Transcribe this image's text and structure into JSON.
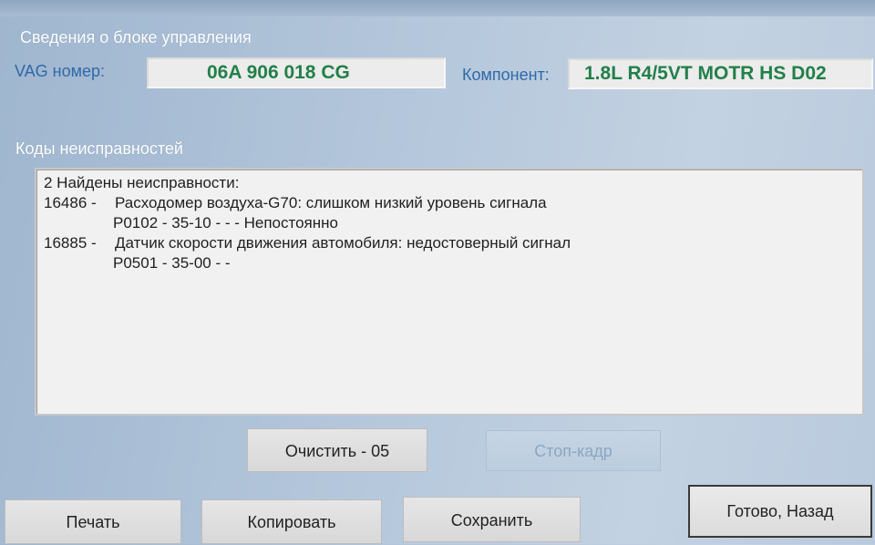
{
  "control_unit": {
    "section_title": "Сведения о блоке управления",
    "vag_label": "VAG номер:",
    "vag_value": "06A 906 018 CG",
    "component_label": "Компонент:",
    "component_value": "1.8L R4/5VT MOTR HS D02"
  },
  "faults": {
    "section_title": "Коды неисправностей",
    "header": "2 Найдены неисправности:",
    "items": [
      {
        "code": "16486 -",
        "description": "Расходомер воздуха-G70: слишком низкий уровень сигнала",
        "detail": "P0102 - 35-10 -    - - Непостоянно"
      },
      {
        "code": "16885 -",
        "description": "Датчик скорости движения автомобиля: недостоверный сигнал",
        "detail": "P0501 - 35-00 -    -"
      }
    ]
  },
  "buttons": {
    "clear": "Очистить - 05",
    "freeze_frame": "Стоп-кадр",
    "print": "Печать",
    "copy": "Копировать",
    "save": "Сохранить",
    "done_back": "Готово, Назад"
  },
  "colors": {
    "label_blue": "#2f69a8",
    "value_green": "#22804a"
  }
}
